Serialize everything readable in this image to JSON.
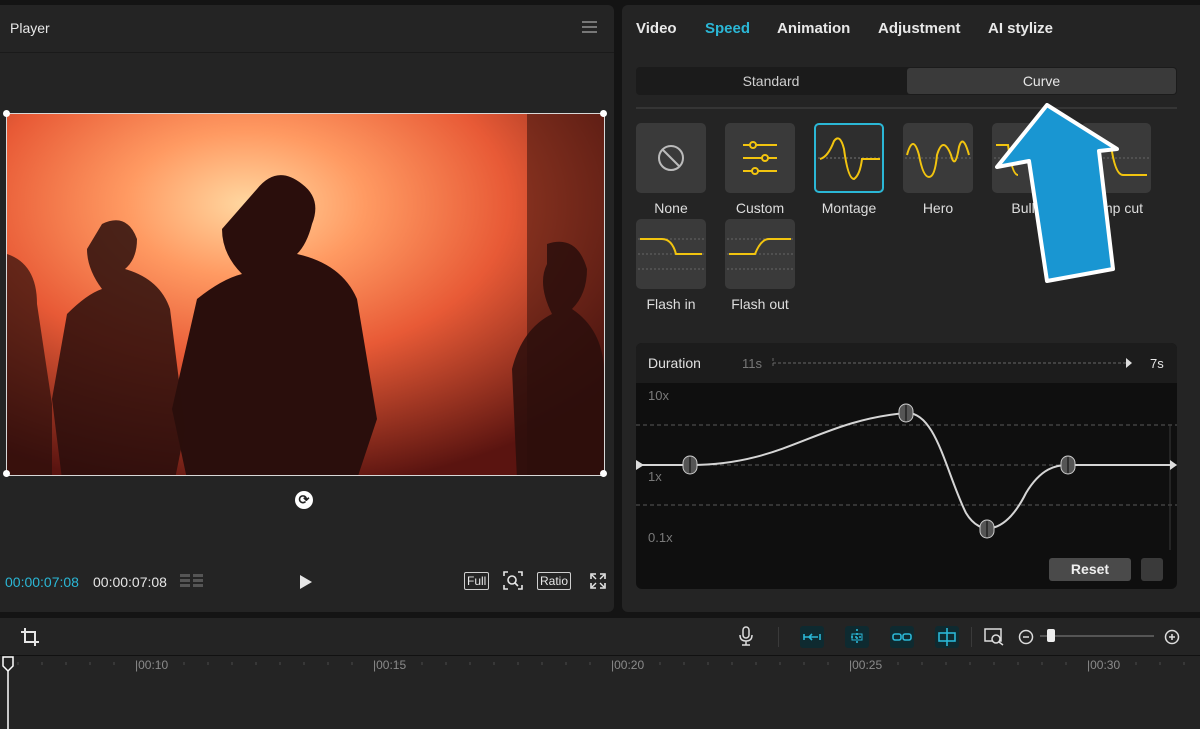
{
  "player": {
    "title": "Player",
    "time_current": "00:00:07:08",
    "time_total": "00:00:07:08",
    "buttons": {
      "full": "Full",
      "ratio": "Ratio"
    }
  },
  "inspector": {
    "tabs": [
      "Video",
      "Speed",
      "Animation",
      "Adjustment",
      "AI stylize"
    ],
    "active_tab": "Speed",
    "mode": {
      "standard": "Standard",
      "curve": "Curve",
      "active": "Curve"
    },
    "presets": [
      {
        "label": "None"
      },
      {
        "label": "Custom"
      },
      {
        "label": "Montage",
        "selected": true
      },
      {
        "label": "Hero"
      },
      {
        "label": "Bulle"
      },
      {
        "label": "mp cut"
      },
      {
        "label": "Flash in"
      },
      {
        "label": "Flash out"
      }
    ],
    "graph": {
      "duration_label": "Duration",
      "from": "11s",
      "to": "7s",
      "y_labels": [
        "10x",
        "1x",
        "0.1x"
      ],
      "reset_label": "Reset"
    }
  },
  "timeline": {
    "ticks": [
      "|00:10",
      "|00:15",
      "|00:20",
      "|00:25",
      "|00:30"
    ]
  },
  "colors": {
    "accent": "#2bb7d6",
    "curve_yellow": "#f2c40f",
    "arrow": "#1996d2"
  }
}
